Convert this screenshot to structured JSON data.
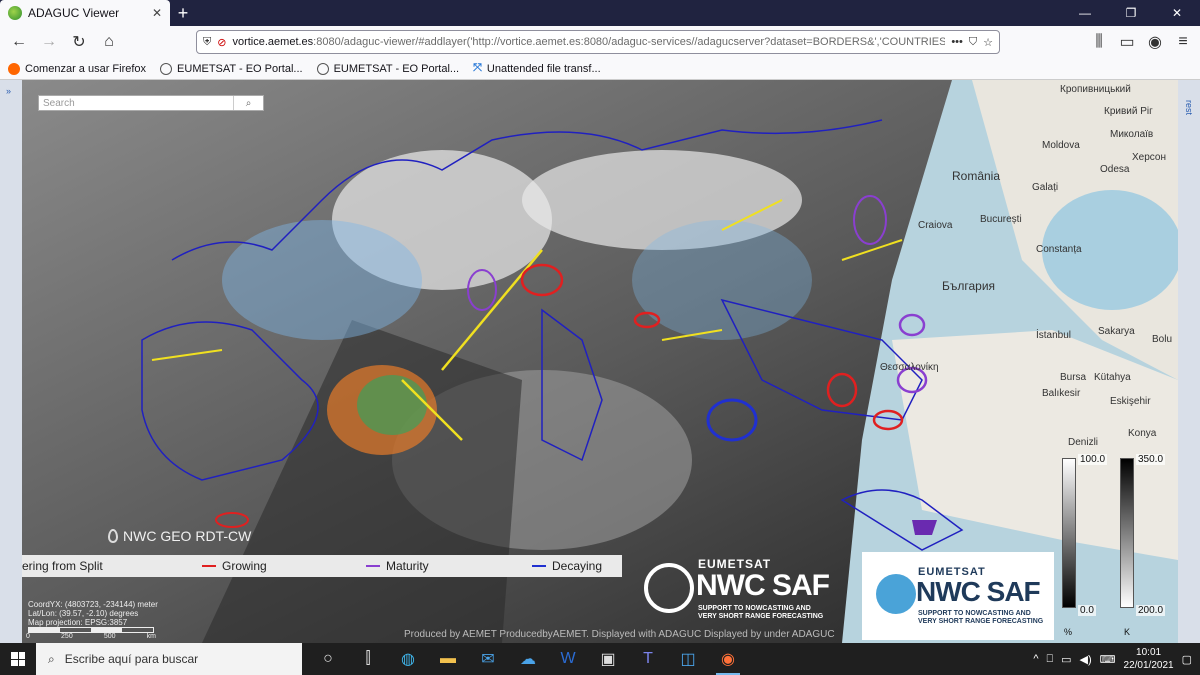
{
  "browser": {
    "tab_title": "ADAGUC Viewer",
    "tab_close": "✕",
    "new_tab": "+",
    "url_prefix": "vortice.aemet.es",
    "url_rest": ":8080/adaguc-viewer/#addlayer('http://vortice.aemet.es:8080/adaguc-services//adagucserver?dataset=BORDERS&','COUNTRIES')",
    "bookmarks": [
      "Comenzar a usar Firefox",
      "EUMETSAT - EO Portal...",
      "EUMETSAT - EO Portal...",
      "Unattended file transf..."
    ],
    "icons": {
      "back": "back-arrow-icon",
      "forward": "forward-arrow-icon",
      "reload": "reload-icon",
      "home": "home-icon"
    }
  },
  "viewer": {
    "left_toggle": "»",
    "right_toggle": "rest",
    "search_placeholder": "Search",
    "layer_name": "NWC GEO RDT-CW",
    "legend": [
      {
        "label": "ering from Split",
        "color": "#e0e0e0"
      },
      {
        "label": "Growing",
        "color": "#e02020"
      },
      {
        "label": "Maturity",
        "color": "#8a3fd0"
      },
      {
        "label": "Decaying",
        "color": "#2030d0"
      }
    ],
    "coords": [
      "CoordYX: (4803723, -234144) meter",
      "Lat/Lon: (39.57, -2.10)  degrees",
      "Map projection: EPSG:3857"
    ],
    "scale_labels": [
      "0",
      "250",
      "500",
      "km"
    ],
    "produced_by": "Produced by AEMET  ProducedbyAEMET. Displayed with ADAGUC  Displayed by under ADAGUC",
    "logo_eum": "EUMETSAT",
    "logo_nwc": "NWC SAF",
    "logo_sub1": "SUPPORT TO NOWCASTING AND",
    "logo_sub2": "VERY SHORT RANGE FORECASTING",
    "colorbar1": {
      "top": "100.0",
      "bottom": "0.0",
      "unit": "%"
    },
    "colorbar2": {
      "top": "350.0",
      "bottom": "200.0",
      "unit": "K"
    },
    "map_labels": [
      {
        "t": "Кропивницький"
      },
      {
        "t": "Кривий Ріг"
      },
      {
        "t": "Миколаїв"
      },
      {
        "t": "Херсон"
      },
      {
        "t": "Odesa"
      },
      {
        "t": "Moldova"
      },
      {
        "t": "România"
      },
      {
        "t": "Galați"
      },
      {
        "t": "Craiova"
      },
      {
        "t": "București"
      },
      {
        "t": "Constanța"
      },
      {
        "t": "България"
      },
      {
        "t": "İstanbul"
      },
      {
        "t": "Sakarya"
      },
      {
        "t": "Bursa"
      },
      {
        "t": "Balıkesir"
      },
      {
        "t": "Eskişehir"
      },
      {
        "t": "Denizli"
      },
      {
        "t": "Konya"
      },
      {
        "t": "Θεσσαλονίκη"
      },
      {
        "t": "Bolu"
      },
      {
        "t": "Kütahya"
      }
    ]
  },
  "taskbar": {
    "search_text": "Escribe aquí para buscar",
    "time": "10:01",
    "date": "22/01/2021",
    "apps": [
      "task-view-icon",
      "snap-icon",
      "edge-icon",
      "explorer-icon",
      "mail-icon",
      "onedrive-icon",
      "word-icon",
      "store-icon",
      "teams-icon",
      "vpn-icon",
      "firefox-icon"
    ]
  }
}
